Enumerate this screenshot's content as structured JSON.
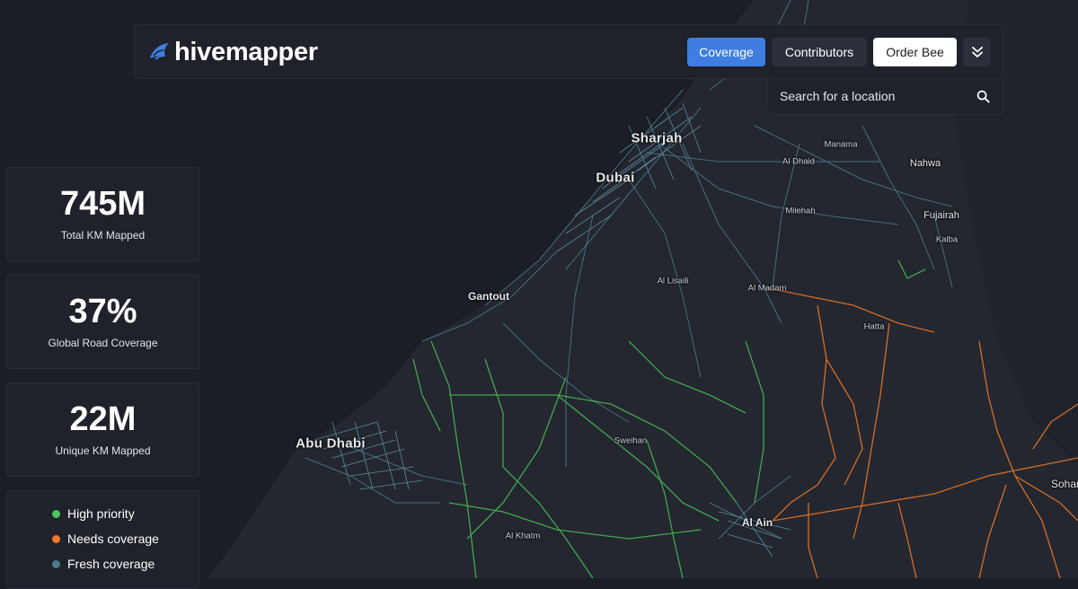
{
  "brand": {
    "name": "hivemapper",
    "logo_icon": "bee-icon",
    "accent": "#3f7de0"
  },
  "nav": {
    "coverage": "Coverage",
    "contributors": "Contributors",
    "order_bee": "Order Bee",
    "more_icon": "double-chevron-down-icon"
  },
  "search": {
    "placeholder": "Search for a location",
    "icon": "search-icon"
  },
  "stats": [
    {
      "value": "745M",
      "label": "Total KM Mapped"
    },
    {
      "value": "37%",
      "label": "Global Road Coverage"
    },
    {
      "value": "22M",
      "label": "Unique KM Mapped"
    }
  ],
  "legend": [
    {
      "label": "High priority",
      "color": "#4cc55a"
    },
    {
      "label": "Needs coverage",
      "color": "#f07a2a"
    },
    {
      "label": "Fresh coverage",
      "color": "#4d7a8a"
    }
  ],
  "map": {
    "places": {
      "sharjah": "Sharjah",
      "dubai": "Dubai",
      "abu_dhabi": "Abu Dhabi",
      "gantout": "Gantout",
      "al_ain": "Al Ain",
      "manama": "Manama",
      "al_dhaid": "Al Dhaid",
      "nahwa": "Nahwa",
      "milehah": "Milehah",
      "fujairah": "Fujairah",
      "kalba": "Kalba",
      "al_lisaili": "Al Lisaili",
      "al_madam": "Al Madam",
      "hatta": "Hatta",
      "sweihan": "Sweihan",
      "al_khatm": "Al Khatm",
      "sohar": "Sohar"
    },
    "colors": {
      "land": "#23262e",
      "sea": "#1b1e26",
      "fresh": "#4d7a8a",
      "priority": "#4cc55a",
      "needs": "#f07a2a"
    }
  }
}
